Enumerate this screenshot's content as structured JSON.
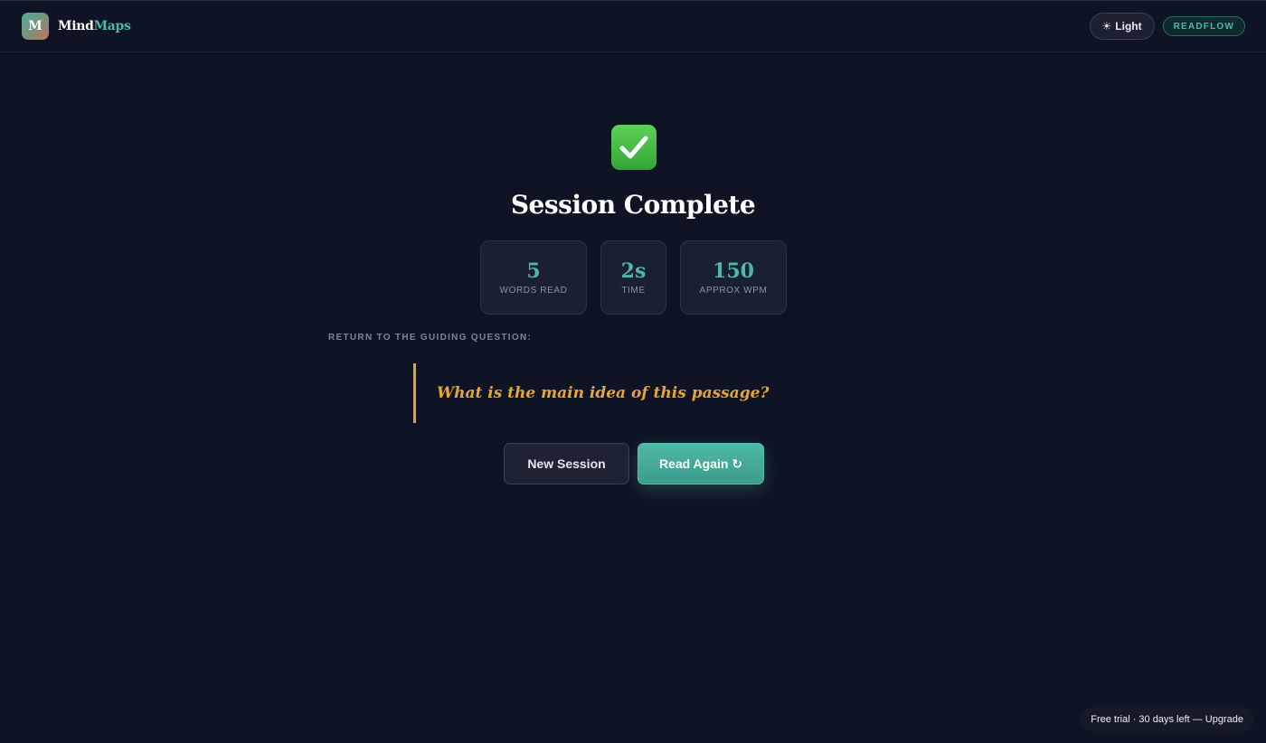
{
  "brand": {
    "logo_letter": "M",
    "name_part1": "Mind",
    "name_part2": "Maps"
  },
  "header": {
    "theme_icon": "☀",
    "theme_label": "Light",
    "badge": "READFLOW"
  },
  "main": {
    "status_icon": "check-mark-icon",
    "title": "Session Complete",
    "stats": [
      {
        "value": "5",
        "label": "WORDS READ"
      },
      {
        "value": "2s",
        "label": "TIME"
      },
      {
        "value": "150",
        "label": "APPROX WPM"
      }
    ],
    "guide_label": "RETURN TO THE GUIDING QUESTION:",
    "guiding_question": "What is the main idea of this passage?",
    "new_session_label": "New Session",
    "read_again_label": "Read Again ↻"
  },
  "footer": {
    "trial_text": "Free trial · 30 days left — Upgrade"
  },
  "colors": {
    "background": "#0e1423",
    "accent": "#4fb7a5",
    "question": "#e8a533",
    "check": "#4cc24a"
  }
}
